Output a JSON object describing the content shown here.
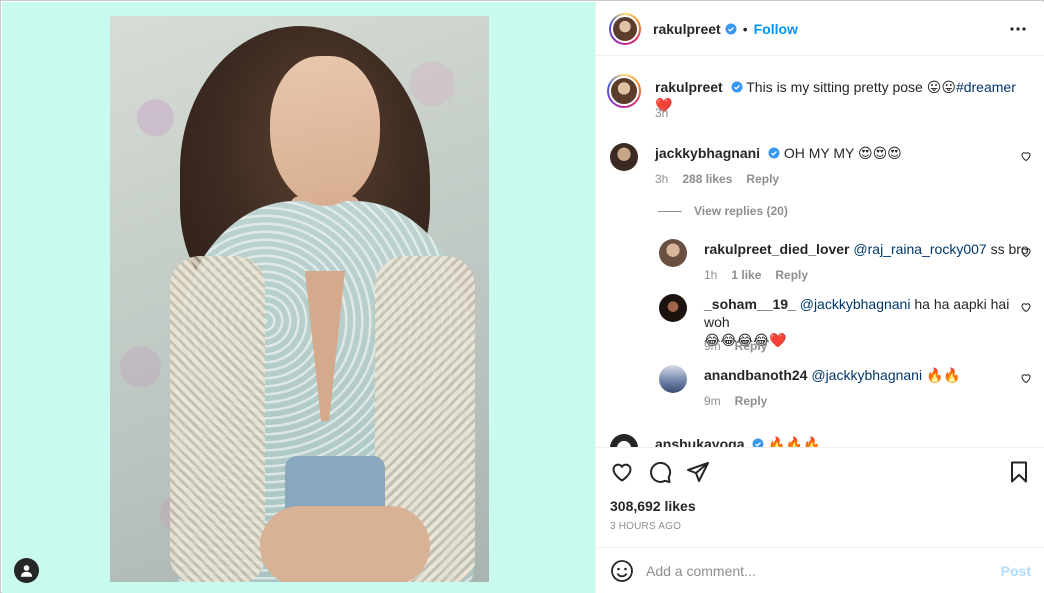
{
  "post": {
    "author": "rakulpreet",
    "follow_label": "Follow",
    "separator": "•",
    "caption": "This is my sitting pretty pose 😛😛",
    "hashtag": "#dreamer",
    "caption_end": "❤️",
    "caption_time": "3h"
  },
  "comments": [
    {
      "user": "jackkybhagnani",
      "verified": true,
      "text": "OH MY MY 😍😍😍",
      "time": "3h",
      "likes": "288 likes",
      "reply_label": "Reply",
      "view_replies": "View replies (20)"
    },
    {
      "user": "rakulpreet_died_lover",
      "mention": "@raj_raina_rocky007",
      "text": " ss bro",
      "time": "1h",
      "likes": "1 like",
      "reply_label": "Reply"
    },
    {
      "user": "_soham__19_",
      "mention": "@jackkybhagnani",
      "text": " ha ha aapki hai woh",
      "text2": "😂😂😂😂❤️",
      "time": "9m",
      "reply_label": "Reply"
    },
    {
      "user": "anandbanoth24",
      "mention": "@jackkybhagnani",
      "text": " 🔥🔥",
      "time": "9m",
      "reply_label": "Reply"
    },
    {
      "user": "anshukayoga",
      "text": "🔥🔥🔥"
    }
  ],
  "actions": {
    "likes_count": "308,692 likes",
    "posted_ago": "3 HOURS AGO"
  },
  "add_comment": {
    "placeholder": "Add a comment...",
    "post_label": "Post"
  },
  "colors": {
    "media_bg": "#c9faf0",
    "accent": "#0095f6",
    "mention": "#00376b",
    "post_disabled": "#b3dbff"
  }
}
